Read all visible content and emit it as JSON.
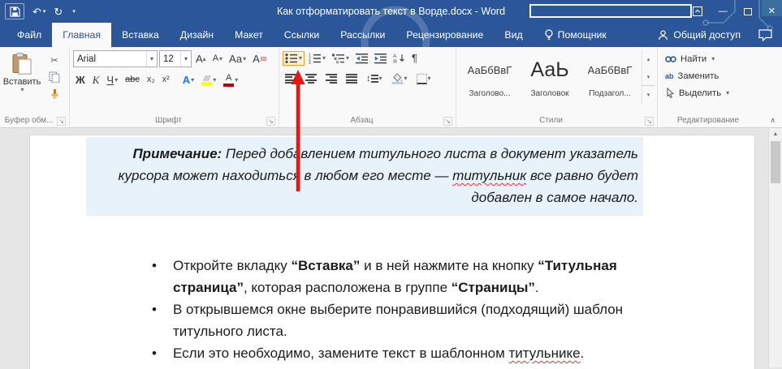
{
  "colors": {
    "titlebar_blue": "#2b579a",
    "arrow_red": "#ee1411",
    "note_background": "#e8f2fa"
  },
  "titlebar": {
    "title": "Как отформатировать текст в Ворде.docx - Word"
  },
  "tabs": {
    "file": "Файл",
    "home": "Главная",
    "insert": "Вставка",
    "design": "Дизайн",
    "layout": "Макет",
    "references": "Ссылки",
    "mailings": "Рассылки",
    "review": "Рецензирование",
    "view": "Вид",
    "assistant": "Помощник",
    "share": "Общий доступ"
  },
  "ribbon": {
    "clipboard": {
      "group_label": "Буфер обм...",
      "paste": "Вставить"
    },
    "font": {
      "group_label": "Шрифт",
      "font_name": "Arial",
      "font_size": "12",
      "grow": "А",
      "shrink": "А",
      "change_case": "Аа",
      "clear_format": "А",
      "bold": "Ж",
      "italic": "К",
      "underline": "Ч",
      "strikethrough": "abc",
      "subscript": "х₂",
      "superscript": "х²",
      "text_effects": "А",
      "font_color": "А"
    },
    "paragraph": {
      "group_label": "Абзац",
      "sort_top": "А",
      "sort_bottom": "Я"
    },
    "styles": {
      "group_label": "Стили",
      "items": [
        {
          "preview": "АаБбВвГ",
          "name": "Заголово..."
        },
        {
          "preview": "АаЬ",
          "name": "Заголовок"
        },
        {
          "preview": "АаБбВвГ",
          "name": "Подзагол..."
        }
      ]
    },
    "editing": {
      "group_label": "Редактирование",
      "find": "Найти",
      "replace": "Заменить",
      "select": "Выделить",
      "replace_icon": "ab"
    }
  },
  "document": {
    "note": {
      "lead": "Примечание:",
      "body_1": " Перед добавлением титульного листа в документ указатель курсора может находиться в любом его месте — ",
      "misspelled": "титульник",
      "body_2": " все равно будет добавлен в самое начало."
    },
    "bullets": [
      {
        "s0": "Откройте вкладку ",
        "s1": "“Вставка”",
        "s2": " и в ней нажмите на кнопку ",
        "s3": "“Титульная страница”",
        "s4": ", которая расположена в группе ",
        "s5": "“Страницы”",
        "s6": "."
      },
      {
        "s0": "В открывшемся окне выберите понравившийся (подходящий) шаблон титульного листа."
      },
      {
        "s0": "Если это необходимо, замените текст в шаблонном ",
        "s1": "титульнике",
        "s2": "."
      }
    ]
  },
  "glyphs": {
    "caret": "▾",
    "caret_up": "▴",
    "bullet": "•",
    "undo": "↶",
    "redo": "↻",
    "pilcrow": "¶",
    "scissors": "✂",
    "launcher": "↘",
    "collapse": "∧",
    "scroll_up": "▲",
    "minimize": "—",
    "close": "✕",
    "updown": "↕",
    "n1": "1",
    "n2": "2",
    "n3": "3"
  }
}
